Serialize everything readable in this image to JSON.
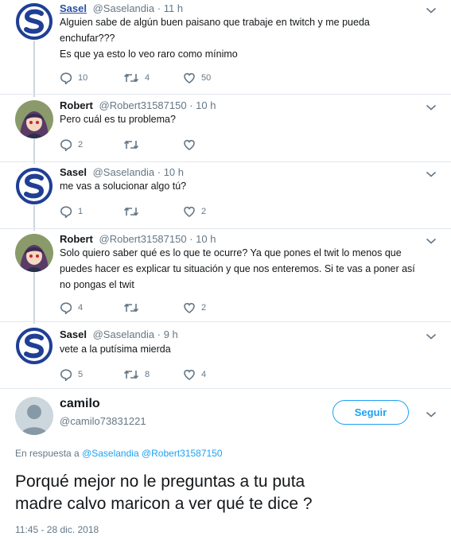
{
  "tweets": [
    {
      "name": "Sasel",
      "handle": "@Saselandia",
      "time": "· 11 h",
      "lines": [
        "Alguien sabe de algún buen paisano que trabaje en twitch y me pueda",
        "enchufar???",
        "Es que ya esto lo veo raro como mínimo"
      ],
      "replies": "10",
      "retweets": "4",
      "likes": "50"
    },
    {
      "name": "Robert",
      "handle": "@Robert31587150",
      "time": "· 10 h",
      "lines": [
        "Pero cuál es tu problema?"
      ],
      "replies": "2",
      "retweets": "",
      "likes": ""
    },
    {
      "name": "Sasel",
      "handle": "@Saselandia",
      "time": "· 10 h",
      "lines": [
        "me vas a solucionar algo tú?"
      ],
      "replies": "1",
      "retweets": "",
      "likes": "2"
    },
    {
      "name": "Robert",
      "handle": "@Robert31587150",
      "time": "· 10 h",
      "lines": [
        "Solo quiero saber qué es lo que te ocurre? Ya que pones el twit lo menos que",
        "puedes hacer es explicar tu situación y que nos enteremos. Si te vas a poner así",
        "no pongas el twit"
      ],
      "replies": "4",
      "retweets": "",
      "likes": "2"
    },
    {
      "name": "Sasel",
      "handle": "@Saselandia",
      "time": "· 9 h",
      "lines": [
        "vete a la putísima mierda"
      ],
      "replies": "5",
      "retweets": "8",
      "likes": "4"
    }
  ],
  "main": {
    "name": "camilo",
    "handle": "@camilo73831221",
    "follow_label": "Seguir",
    "reply_prefix": "En respuesta a",
    "reply_to": "@Saselandia @Robert31587150",
    "text_lines": [
      "Porqué mejor no le preguntas a tu puta",
      "madre calvo maricon a ver qué te dice ?"
    ],
    "timestamp": "11:45 - 28 dic. 2018"
  },
  "colors": {
    "accent": "#1da1f2",
    "muted": "#657786",
    "logo_blue": "#1f3f95"
  },
  "icons": [
    "sasel-logo",
    "anime-avatar",
    "default-avatar",
    "reply-icon",
    "retweet-icon",
    "like-icon",
    "chevron-down-icon"
  ]
}
